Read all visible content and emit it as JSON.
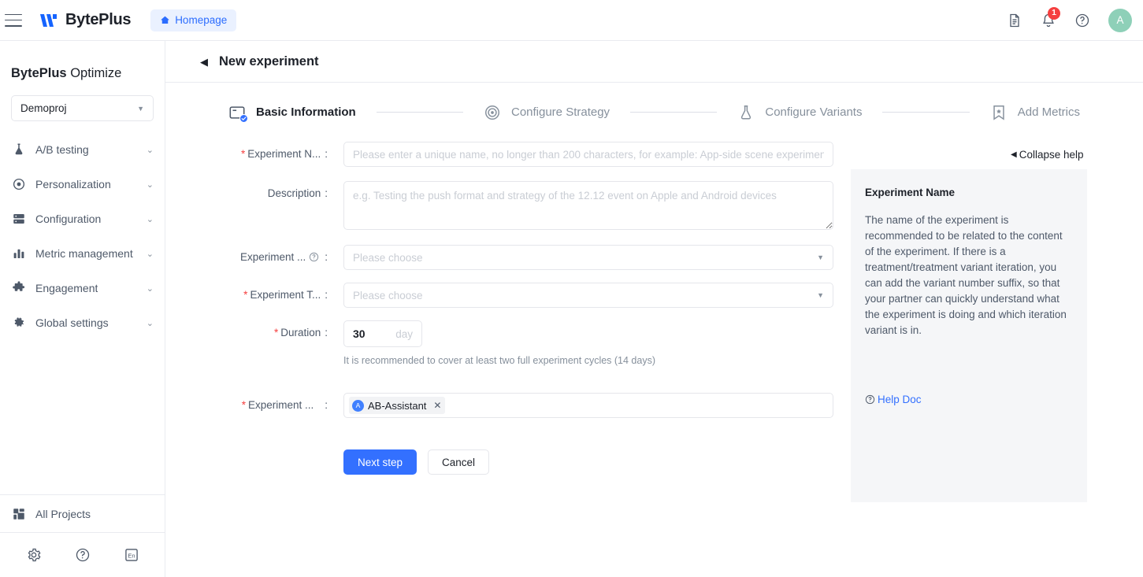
{
  "topbar": {
    "brand": "BytePlus",
    "homepage_label": "Homepage",
    "notification_count": "1",
    "avatar_initial": "A",
    "icons": {
      "menu": "hamburger-icon",
      "doc": "document-icon",
      "bell": "bell-icon",
      "help": "help-circle-icon",
      "home": "home-icon"
    }
  },
  "sidebar": {
    "product_bold": "BytePlus",
    "product_rest": " Optimize",
    "project": "Demoproj",
    "items": [
      {
        "label": "A/B testing",
        "icon": "flask-icon"
      },
      {
        "label": "Personalization",
        "icon": "target-dot-icon"
      },
      {
        "label": "Configuration",
        "icon": "server-icon"
      },
      {
        "label": "Metric management",
        "icon": "bar-chart-icon"
      },
      {
        "label": "Engagement",
        "icon": "puzzle-icon"
      },
      {
        "label": "Global settings",
        "icon": "gear-icon"
      }
    ],
    "all_projects": "All Projects",
    "tools": [
      {
        "name": "settings-gear-icon"
      },
      {
        "name": "help-circle-icon"
      },
      {
        "name": "language-en-icon",
        "label": "En"
      }
    ]
  },
  "page": {
    "title": "New experiment",
    "collapse_help": "Collapse help"
  },
  "steps": [
    {
      "label": "Basic Information",
      "icon": "card-check-icon",
      "active": true
    },
    {
      "label": "Configure Strategy",
      "icon": "target-icon",
      "active": false
    },
    {
      "label": "Configure Variants",
      "icon": "flask-outline-icon",
      "active": false
    },
    {
      "label": "Add Metrics",
      "icon": "bookmark-star-icon",
      "active": false
    }
  ],
  "form": {
    "experiment_name": {
      "label": "Experiment N...",
      "required": true,
      "value": "",
      "placeholder": "Please enter a unique name, no longer than 200 characters, for example: App-side scene experiment"
    },
    "description": {
      "label": "Description",
      "required": false,
      "value": "",
      "placeholder": "e.g. Testing the push format and strategy of the 12.12 event on Apple and Android devices"
    },
    "experiment_category": {
      "label": "Experiment ...",
      "required": false,
      "has_help_icon": true,
      "value": "Please choose"
    },
    "experiment_type": {
      "label": "Experiment T...",
      "required": true,
      "value": "Please choose"
    },
    "duration": {
      "label": "Duration",
      "required": true,
      "value": "30",
      "unit": "day",
      "hint": "It is recommended to cover at least two full experiment cycles (14 days)"
    },
    "experiment_owner": {
      "label": "Experiment ...",
      "required": true,
      "tags": [
        {
          "avatar": "A",
          "name": "AB-Assistant"
        }
      ]
    },
    "buttons": {
      "next": "Next step",
      "cancel": "Cancel"
    }
  },
  "help_panel": {
    "heading": "Experiment Name",
    "body": "The name of the experiment is recommended to be related to the content of the experiment. If there is a treatment/treatment variant iteration, you can add the variant number suffix, so that your partner can quickly understand what the experiment is doing and which iteration variant is in.",
    "doc_link": "Help Doc"
  },
  "colors": {
    "accent_blue": "#3370ff",
    "link_blue": "#2c6dff",
    "badge_red": "#f53f3f",
    "avatar_green": "#8ed0b8",
    "panel_bg": "#f5f6f8",
    "border": "#e5e6eb"
  }
}
